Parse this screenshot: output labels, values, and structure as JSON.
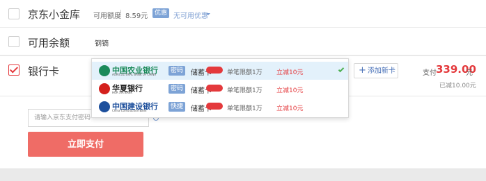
{
  "options": {
    "jd_xiaojinku": {
      "label": "京东小金库",
      "available_label": "可用额度",
      "available_amount": "8.59元",
      "promo_tag": "优惠",
      "promo_text": "无可用优惠"
    },
    "balance": {
      "label": "可用余额",
      "hint": "钢镝"
    },
    "bank_card": {
      "label": "银行卡",
      "add_card": "添加新卡",
      "pay_label": "支付",
      "pay_amount": "339.00",
      "pay_unit": "元",
      "saved": "已减10.00元"
    }
  },
  "dropdown": {
    "banks": [
      {
        "name": "中国农业银行",
        "en": "AGRICULTURAL BANK OF CHINA",
        "type": "密码",
        "kind": "储蓄卡",
        "limit": "单笔限额1万",
        "discount": "立减10元",
        "emblem_color": "#1b8a5a",
        "name_color": "#1b8a5a"
      },
      {
        "name": "华夏银行",
        "en": "HUA XIA BANK",
        "type": "密码",
        "kind": "储蓄卡",
        "limit": "单笔限额1万",
        "discount": "立减10元",
        "emblem_color": "#d4201c",
        "name_color": "#222"
      },
      {
        "name": "中国建设银行",
        "en": "China Construction Bank",
        "type": "快捷",
        "kind": "储蓄卡",
        "limit": "单笔限额1万",
        "discount": "立减10元",
        "emblem_color": "#1d4f9c",
        "name_color": "#1d4f9c"
      }
    ]
  },
  "password": {
    "placeholder": "请输入京东支付密码"
  },
  "submit": {
    "label": "立即支付"
  },
  "colors": {
    "accent_red": "#e4393c",
    "button_red": "#ef6c66",
    "link_blue": "#7a9cd1"
  }
}
